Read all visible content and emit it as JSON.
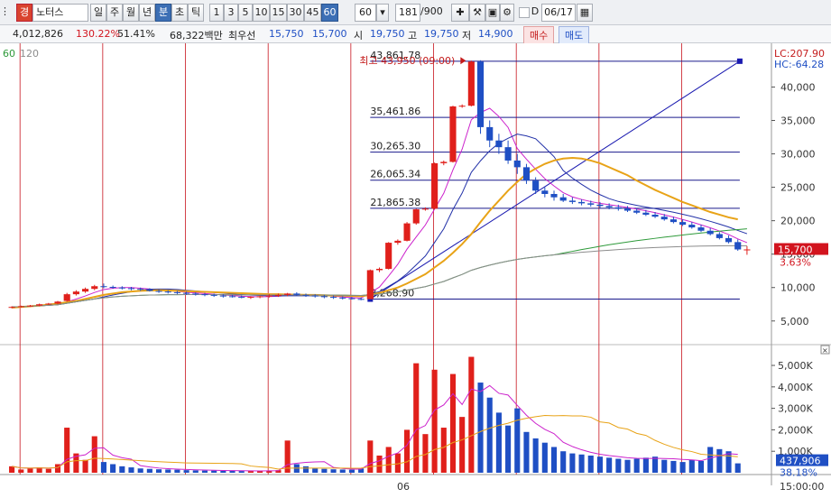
{
  "toolbar": {
    "stock_badge": "경",
    "stock_name": "노터스",
    "period_tabs": [
      "일",
      "주",
      "월",
      "년",
      "분",
      "초",
      "틱"
    ],
    "active_period": "분",
    "interval_buttons": [
      "1",
      "3",
      "5",
      "10",
      "15",
      "30",
      "45",
      "60"
    ],
    "active_interval": "60",
    "interval_select": "60",
    "count_value": "181",
    "count_total": "/900",
    "date_checkbox_label": "D",
    "date_value": "06/17"
  },
  "info": {
    "volume": "4,012,826",
    "volume_ratio": "130.22%",
    "turnover_rate": "51.41%",
    "amount": "68,322백만",
    "best_bid_label": "최우선",
    "best_ask": "15,750",
    "best_bid": "15,700",
    "open_label": "시",
    "open": "19,750",
    "high_label": "고",
    "high": "19,750",
    "low_label": "저",
    "low": "14,900",
    "buy_label": "매수",
    "sell_label": "매도"
  },
  "legend": {
    "ma1": "60",
    "ma2": "120"
  },
  "colors": {
    "up": "#e0201b",
    "down": "#1f4fc4",
    "ma_orange": "#e8a317",
    "ma_green": "#2e9a3a",
    "ma_gray": "#8c8c8c",
    "ma_magenta": "#cc22cc",
    "ma_blue": "#2231a8",
    "fib_line": "#1a1a8c",
    "vline": "#c8141e"
  },
  "chart_data": {
    "type": "candlestick",
    "timeframe": "60-minute",
    "current_price": "15,700",
    "change_percent": "3.63%",
    "lc_label": "LC:207.90",
    "hc_label": "HC:-64.28",
    "high_annotation": "최고 43,950 (09:00)",
    "fib_levels": [
      43861.78,
      35461.86,
      30265.3,
      26065.34,
      21865.38,
      8268.9
    ],
    "fib_labels": [
      "43,861.78",
      "35,461.86",
      "30,265.30",
      "26,065.34",
      "21,865.38",
      "8,268.90"
    ],
    "price_axis": {
      "ticks": [
        5000,
        10000,
        15000,
        20000,
        25000,
        30000,
        35000,
        40000
      ],
      "labels": [
        "5,000",
        "10,000",
        "15,000",
        "20,000",
        "25,000",
        "30,000",
        "35,000",
        "40,000"
      ]
    },
    "volume_axis": {
      "ticks": [
        1000,
        2000,
        3000,
        4000,
        5000
      ],
      "labels": [
        "1,000K",
        "2,000K",
        "3,000K",
        "4,000K",
        "5,000K"
      ]
    },
    "current_volume": "437,906",
    "volume_ratio": "38.18%",
    "x_axis_labels": [
      "06"
    ],
    "time_label": "15:00:00",
    "candles": [
      [
        7000,
        7200,
        6900,
        7100
      ],
      [
        7100,
        7300,
        7000,
        7200
      ],
      [
        7200,
        7400,
        7100,
        7300
      ],
      [
        7300,
        7600,
        7200,
        7500
      ],
      [
        7500,
        7700,
        7400,
        7600
      ],
      [
        7600,
        8000,
        7500,
        7900
      ],
      [
        8000,
        9200,
        7900,
        9000
      ],
      [
        9000,
        9600,
        8800,
        9400
      ],
      [
        9400,
        10000,
        9200,
        9800
      ],
      [
        9800,
        10400,
        9600,
        10200
      ],
      [
        10200,
        10600,
        9900,
        10100
      ],
      [
        10100,
        10300,
        9800,
        10000
      ],
      [
        10000,
        10200,
        9700,
        9900
      ],
      [
        9900,
        10100,
        9600,
        9800
      ],
      [
        9800,
        10000,
        9500,
        9700
      ],
      [
        9700,
        9900,
        9400,
        9500
      ],
      [
        9500,
        9700,
        9200,
        9400
      ],
      [
        9400,
        9600,
        9100,
        9300
      ],
      [
        9300,
        9500,
        9000,
        9200
      ],
      [
        9200,
        9400,
        8900,
        9100
      ],
      [
        9100,
        9300,
        8800,
        9000
      ],
      [
        9000,
        9200,
        8700,
        8900
      ],
      [
        8900,
        9100,
        8600,
        8800
      ],
      [
        8800,
        9000,
        8500,
        8700
      ],
      [
        8700,
        8900,
        8500,
        8600
      ],
      [
        8600,
        8800,
        8400,
        8500
      ],
      [
        8500,
        8700,
        8300,
        8600
      ],
      [
        8600,
        8800,
        8400,
        8700
      ],
      [
        8700,
        9000,
        8500,
        8800
      ],
      [
        8800,
        9100,
        8600,
        8900
      ],
      [
        8900,
        9200,
        8700,
        9100
      ],
      [
        9100,
        9300,
        8800,
        8900
      ],
      [
        8900,
        9100,
        8600,
        8800
      ],
      [
        8800,
        9000,
        8500,
        8700
      ],
      [
        8700,
        8900,
        8400,
        8600
      ],
      [
        8600,
        8800,
        8300,
        8500
      ],
      [
        8500,
        8700,
        8200,
        8400
      ],
      [
        8400,
        8600,
        8200,
        8300
      ],
      [
        8300,
        8500,
        8100,
        8268
      ],
      [
        8268,
        12700,
        8268,
        12600
      ],
      [
        12600,
        13000,
        12300,
        12800
      ],
      [
        12800,
        16800,
        12700,
        16700
      ],
      [
        16700,
        17200,
        16400,
        17000
      ],
      [
        17000,
        19800,
        16900,
        19600
      ],
      [
        19600,
        21800,
        19400,
        21700
      ],
      [
        21700,
        22000,
        21500,
        21800
      ],
      [
        21800,
        28700,
        21700,
        28600
      ],
      [
        28600,
        29000,
        28300,
        28800
      ],
      [
        28800,
        37200,
        28700,
        37100
      ],
      [
        37100,
        37400,
        36900,
        37200
      ],
      [
        37200,
        43950,
        37100,
        43800
      ],
      [
        43800,
        44000,
        33000,
        34000
      ],
      [
        34000,
        35000,
        31000,
        32000
      ],
      [
        32000,
        33000,
        30000,
        31000
      ],
      [
        31000,
        32000,
        28500,
        29000
      ],
      [
        29000,
        30000,
        27000,
        28000
      ],
      [
        28000,
        28500,
        25500,
        26000
      ],
      [
        26000,
        26500,
        24000,
        24500
      ],
      [
        24500,
        25000,
        23500,
        24000
      ],
      [
        24000,
        24500,
        23000,
        23500
      ],
      [
        23500,
        24000,
        22800,
        23000
      ],
      [
        23000,
        23500,
        22500,
        22800
      ],
      [
        22800,
        23200,
        22300,
        22600
      ],
      [
        22600,
        23000,
        22100,
        22400
      ],
      [
        22400,
        22800,
        21900,
        22200
      ],
      [
        22200,
        22600,
        21700,
        22000
      ],
      [
        22000,
        22400,
        21500,
        21800
      ],
      [
        21800,
        22200,
        21300,
        21500
      ],
      [
        21500,
        21900,
        21000,
        21200
      ],
      [
        21200,
        21600,
        20700,
        20900
      ],
      [
        20900,
        21300,
        20400,
        20600
      ],
      [
        20600,
        21000,
        20000,
        20200
      ],
      [
        20200,
        20600,
        19600,
        19800
      ],
      [
        19800,
        20200,
        19200,
        19400
      ],
      [
        19400,
        19800,
        18800,
        19000
      ],
      [
        19000,
        19400,
        18300,
        18500
      ],
      [
        18500,
        18900,
        17800,
        18000
      ],
      [
        18000,
        18300,
        17200,
        17400
      ],
      [
        17400,
        17800,
        16600,
        16800
      ],
      [
        16800,
        17200,
        15500,
        15700
      ],
      [
        15700,
        16200,
        14900,
        15700
      ]
    ],
    "volumes": [
      300,
      150,
      200,
      250,
      180,
      400,
      2100,
      900,
      600,
      1700,
      500,
      400,
      300,
      250,
      200,
      180,
      160,
      150,
      140,
      120,
      110,
      100,
      100,
      90,
      90,
      80,
      80,
      90,
      100,
      120,
      1500,
      400,
      300,
      200,
      180,
      160,
      150,
      140,
      200,
      1500,
      800,
      1200,
      900,
      2000,
      5100,
      1800,
      4800,
      2100,
      4600,
      2600,
      5400,
      4200,
      3500,
      2800,
      2200,
      3000,
      1900,
      1600,
      1400,
      1200,
      1000,
      900,
      850,
      800,
      750,
      700,
      650,
      600,
      650,
      700,
      750,
      600,
      550,
      500,
      600,
      550,
      1200,
      1100,
      1000,
      437
    ],
    "ma_series": {
      "orange_20": [
        7000,
        7100,
        7200,
        7300,
        7450,
        7600,
        7800,
        8000,
        8300,
        8600,
        8900,
        9100,
        9300,
        9400,
        9500,
        9550,
        9600,
        9550,
        9500,
        9450,
        9400,
        9350,
        9300,
        9250,
        9200,
        9150,
        9100,
        9050,
        9000,
        9000,
        8950,
        8950,
        8900,
        8900,
        8850,
        8800,
        8800,
        8750,
        8700,
        8900,
        9200,
        9600,
        10000,
        10600,
        11300,
        12000,
        13000,
        14000,
        15200,
        16500,
        18000,
        19800,
        21500,
        23000,
        24500,
        25800,
        27000,
        27800,
        28500,
        29000,
        29300,
        29400,
        29300,
        29000,
        28600,
        28000,
        27400,
        26800,
        26000,
        25300,
        24600,
        24000,
        23400,
        22800,
        22300,
        21800,
        21300,
        20900,
        20500,
        20200
      ]
    }
  }
}
